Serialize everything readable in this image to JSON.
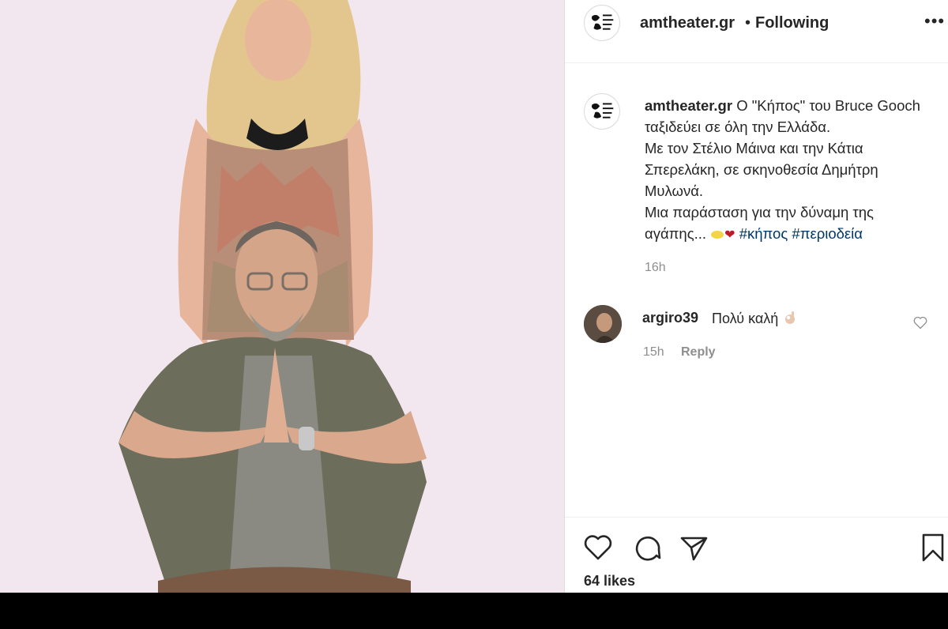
{
  "post": {
    "username": "amtheater.gr",
    "separator": "•",
    "follow_status": "Following",
    "more_label": "•••"
  },
  "caption": {
    "username": "amtheater.gr",
    "text_line1": "Ο \"Κήπος\" του Bruce Gooch ταξιδεύει σε όλη την Ελλάδα.",
    "text_line2": "Με τον Στέλιο Μάινα και την Κάτια Σπερελάκη, σε σκηνοθεσία Δημήτρη Μυλωνά.",
    "text_line3": "Μια παράσταση για την δύναμη της αγάπης...",
    "hashtag1": "#κήπος",
    "hashtag2": "#περιοδεία",
    "time": "16h"
  },
  "comment": {
    "username": "argiro39",
    "text": "Πολύ καλή",
    "time": "15h",
    "reply_label": "Reply"
  },
  "actions": {
    "likes_text": "64 likes"
  },
  "colors": {
    "text": "#262626",
    "secondary": "#8e8e8e",
    "hashtag": "#00376b",
    "photo_bg": "#f3e7ef"
  }
}
